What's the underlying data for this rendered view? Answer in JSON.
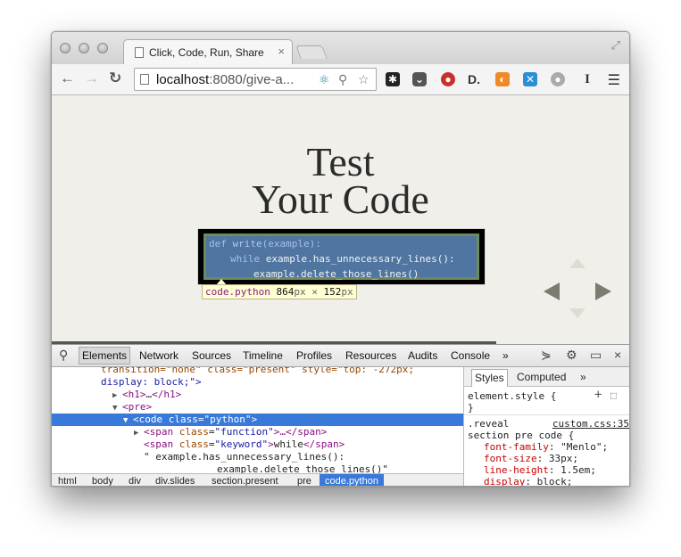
{
  "tab": {
    "title": "Click, Code, Run, Share",
    "close": "×"
  },
  "omnibox": {
    "host": "localhost",
    "rest": ":8080/give-a..."
  },
  "nav": {
    "back": "←",
    "forward": "→",
    "reload": "↻"
  },
  "slide": {
    "title_line1": "Test",
    "title_line2": "Your Code",
    "code": {
      "line1_kw": "def",
      "line1_fn": "write",
      "line1_rest": "(example):",
      "line2_kw": "while",
      "line2_rest": "example.has_unnecessary_lines():",
      "line3": "example.delete_those_lines()"
    },
    "tooltip": {
      "tag": "code.python",
      "w": "864",
      "unit1": "px",
      "x": " × ",
      "h": "152",
      "unit2": "px"
    }
  },
  "devtools": {
    "tabs": [
      "Elements",
      "Network",
      "Sources",
      "Timeline",
      "Profiles",
      "Resources",
      "Audits",
      "Console"
    ],
    "more": "»",
    "close": "×",
    "dom": {
      "l0": "transition=\"none\" class=\"present\" style=\"top: -272px;",
      "l1": "display: block;\">",
      "l2_open": "<h1>",
      "l2_mid": "…",
      "l2_close": "</h1>",
      "l3": "<pre>",
      "l4_tag": "<code",
      "l4_attr": "class",
      "l4_val": "\"python\"",
      "l5_tag": "<span",
      "l5_attr": "class",
      "l5_val": "\"function\"",
      "l5_rest": ">…</span>",
      "l6_tag": "<span",
      "l6_attr": "class",
      "l6_val": "\"keyword\"",
      "l6_text": "while",
      "l6_close": "</span>",
      "l7": "\" example.has_unnecessary_lines():",
      "l8": "example.delete_those_lines()\""
    },
    "breadcrumbs": [
      "html",
      "body",
      "div",
      "div.slides",
      "section.present",
      "pre",
      "code.python"
    ],
    "styles": {
      "tab_styles": "Styles",
      "tab_computed": "Computed",
      "element_style": "element.style {",
      "close_brace": "}",
      "rule_selector1": ".reveal",
      "rule_selector2": "section pre code {",
      "source": "custom.css:35",
      "props": [
        {
          "name": "font-family",
          "value": "\"Menlo\";"
        },
        {
          "name": "font-size",
          "value": "33px;"
        },
        {
          "name": "line-height",
          "value": "1.5em;"
        },
        {
          "name": "display",
          "value": "block;"
        }
      ]
    }
  }
}
